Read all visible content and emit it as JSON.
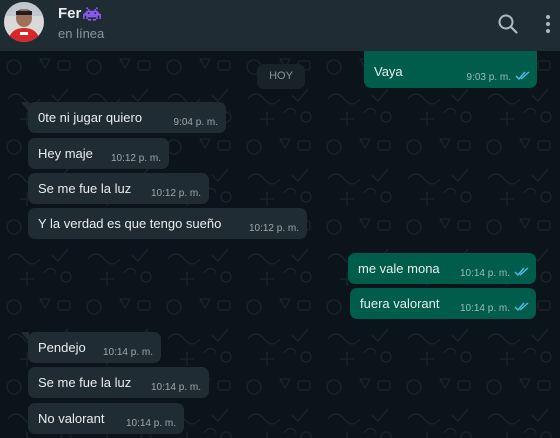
{
  "header": {
    "contact_name": "Fer",
    "status": "en línea"
  },
  "icons": {
    "name_emoji": "alien-monster-icon",
    "search": "search-icon",
    "menu": "kebab-menu-icon",
    "read_receipt": "double-check-icon"
  },
  "colors": {
    "header_bg": "#202c33",
    "chat_bg": "#0b141a",
    "incoming_bubble": "#202c33",
    "outgoing_bubble": "#005c4b",
    "read_check": "#53bdeb",
    "emoji_purple": "#8b5cf6"
  },
  "date_divider": "HOY",
  "messages": [
    {
      "dir": "out",
      "text": "Vaya",
      "time": "9:03 p. m.",
      "read": true
    },
    {
      "dir": "in",
      "text": "0te ni jugar quiero",
      "time": "9:04 p. m."
    },
    {
      "dir": "in",
      "text": "Hey maje",
      "time": "10:12 p. m."
    },
    {
      "dir": "in",
      "text": "Se me fue la luz",
      "time": "10:12 p. m."
    },
    {
      "dir": "in",
      "text": "Y la verdad es que tengo sueño",
      "time": "10:12 p. m."
    },
    {
      "dir": "out",
      "text": "me vale mona",
      "time": "10:14 p. m.",
      "read": true
    },
    {
      "dir": "out",
      "text": "fuera valorant",
      "time": "10:14 p. m.",
      "read": true
    },
    {
      "dir": "in",
      "text": "Pendejo",
      "time": "10:14 p. m."
    },
    {
      "dir": "in",
      "text": "Se me fue la luz",
      "time": "10:14 p. m."
    },
    {
      "dir": "in",
      "text": "No valorant",
      "time": "10:14 p. m."
    }
  ]
}
